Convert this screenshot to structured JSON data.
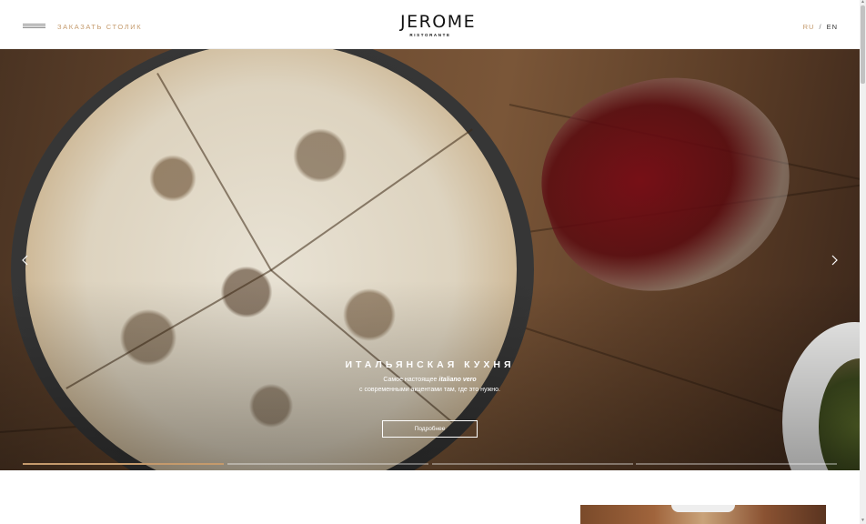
{
  "header": {
    "reserve_label": "ЗАКАЗАТЬ СТОЛИК",
    "logo_main": "JEROME",
    "logo_sub": "RISTORANTE",
    "lang_active": "RU",
    "lang_separator": "/",
    "lang_other": "EN"
  },
  "hero": {
    "title": "ИТАЛЬЯНСКАЯ КУХНЯ",
    "line1_prefix": "Самое настоящее ",
    "line1_emph": "italiano vero",
    "line2": "с современными акцентами там, где это нужно.",
    "button_label": "Подробнее",
    "slides_total": 4,
    "active_slide": 1,
    "active_slide_progress": 1.0
  },
  "icons": {
    "menu": "hamburger-icon",
    "prev": "chevron-left-icon",
    "next": "chevron-right-icon",
    "scroll_up": "triangle-up-icon",
    "scroll_down": "triangle-down-icon"
  },
  "colors": {
    "accent": "#c49a6c",
    "text": "#1a1a1a",
    "background": "#ffffff"
  }
}
